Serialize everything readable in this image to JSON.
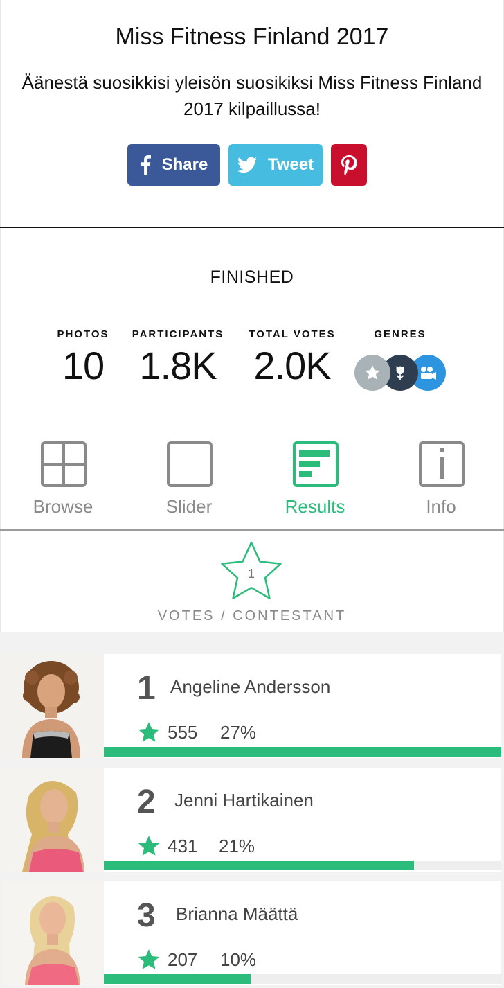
{
  "header": {
    "title": "Miss Fitness Finland 2017",
    "description": "Äänestä suosikkisi yleisön suosikiksi Miss Fitness Finland 2017 kilpaillussa!"
  },
  "share": {
    "facebook_label": "Share",
    "twitter_label": "Tweet",
    "facebook_color": "#3b5998",
    "twitter_color": "#45bce0",
    "pinterest_color": "#c8102e"
  },
  "status": "FINISHED",
  "stats": {
    "photos": {
      "label": "PHOTOS",
      "value": "10"
    },
    "participants": {
      "label": "PARTICIPANTS",
      "value": "1.8K"
    },
    "total_votes": {
      "label": "TOTAL VOTES",
      "value": "2.0K"
    },
    "genres": {
      "label": "GENRES",
      "icons": [
        "star-icon",
        "rose-icon",
        "video-camera-icon"
      ]
    }
  },
  "tabs": [
    {
      "label": "Browse",
      "icon": "grid-icon",
      "active": false
    },
    {
      "label": "Slider",
      "icon": "square-icon",
      "active": false
    },
    {
      "label": "Results",
      "icon": "bar-chart-icon",
      "active": true
    },
    {
      "label": "Info",
      "icon": "info-icon",
      "active": false
    }
  ],
  "votes_per_contestant": {
    "value": "1",
    "label": "VOTES / CONTESTANT"
  },
  "accent_color": "#2bbb7a",
  "results": [
    {
      "rank": "1",
      "name": "Angeline Andersson",
      "votes": "555",
      "percent": "27%",
      "bar_fraction": 1.0
    },
    {
      "rank": "2",
      "name": "Jenni Hartikainen",
      "votes": "431",
      "percent": "21%",
      "bar_fraction": 0.78
    },
    {
      "rank": "3",
      "name": "Brianna Määttä",
      "votes": "207",
      "percent": "10%",
      "bar_fraction": 0.37
    }
  ]
}
